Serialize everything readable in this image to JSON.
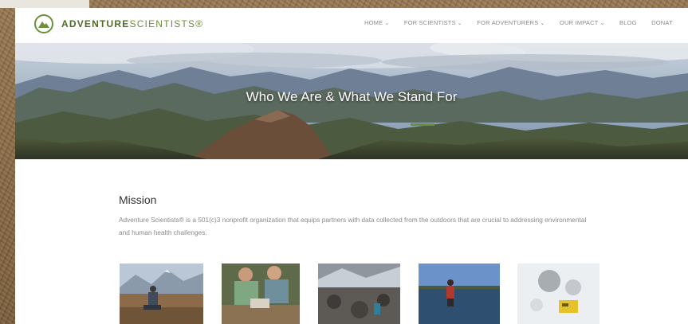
{
  "brand": {
    "name_bold": "ADVENTURE",
    "name_light": "SCIENTISTS",
    "trademark": "®",
    "logo_icon": "mountain-icon",
    "color_primary": "#6b8f3a",
    "color_dark": "#4e6b27"
  },
  "nav": {
    "items": [
      {
        "label": "HOME",
        "dropdown": true
      },
      {
        "label": "FOR SCIENTISTS",
        "dropdown": true
      },
      {
        "label": "FOR ADVENTURERS",
        "dropdown": true
      },
      {
        "label": "OUR IMPACT",
        "dropdown": true
      },
      {
        "label": "BLOG",
        "dropdown": false
      },
      {
        "label": "DONAT",
        "dropdown": false
      }
    ],
    "chevron_icon": "chevron-down-icon"
  },
  "hero": {
    "title": "Who We Are & What We Stand For"
  },
  "mission": {
    "heading": "Mission",
    "text": "Adventure Scientists® is a 501(c)3 nonprofit organization that equips partners with data collected from the outdoors that are crucial to addressing environmental and human health challenges."
  },
  "photos": [
    {
      "icon": "photo-icon",
      "subject": "mountain-researcher"
    },
    {
      "icon": "photo-icon",
      "subject": "scientists-group"
    },
    {
      "icon": "photo-icon",
      "subject": "rocky-stream"
    },
    {
      "icon": "photo-icon",
      "subject": "wading-lake"
    },
    {
      "icon": "photo-icon",
      "subject": "snow-sample"
    }
  ]
}
